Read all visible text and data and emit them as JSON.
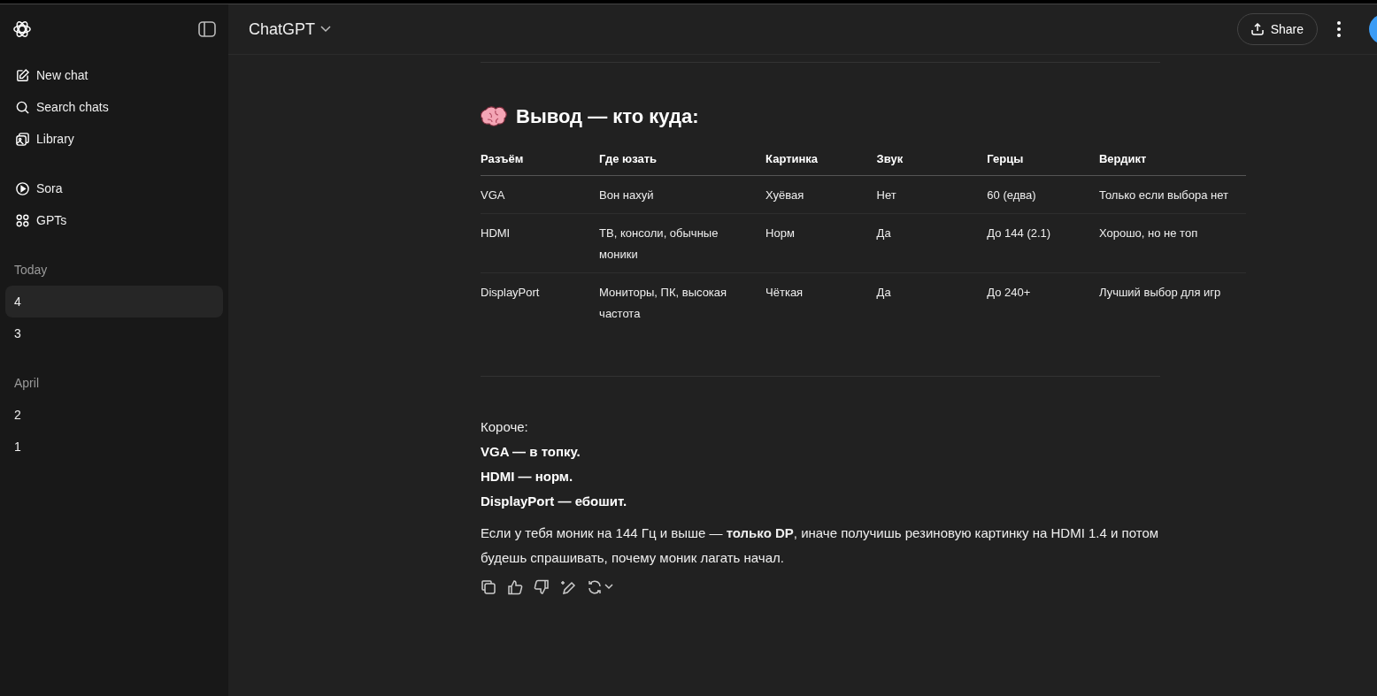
{
  "sidebar": {
    "nav": [
      {
        "kind": "new",
        "label": "New chat"
      },
      {
        "kind": "search",
        "label": "Search chats"
      },
      {
        "kind": "library",
        "label": "Library"
      },
      {
        "kind": "sora",
        "label": "Sora"
      },
      {
        "kind": "gpts",
        "label": "GPTs"
      }
    ],
    "sections": [
      {
        "title": "Today",
        "chats": [
          {
            "label": "4",
            "selected": true
          },
          {
            "label": "3",
            "selected": false
          }
        ]
      },
      {
        "title": "April",
        "chats": [
          {
            "label": "2",
            "selected": false
          },
          {
            "label": "1",
            "selected": false
          }
        ]
      }
    ]
  },
  "header": {
    "model": "ChatGPT",
    "share": "Share"
  },
  "message": {
    "heading": "Вывод — кто куда:",
    "table": {
      "columns": [
        "Разъём",
        "Где юзать",
        "Картинка",
        "Звук",
        "Герцы",
        "Вердикт"
      ],
      "rows": [
        [
          "VGA",
          "Вон нахуй",
          "Хуёвая",
          "Нет",
          "60 (едва)",
          "Только если выбора нет"
        ],
        [
          "HDMI",
          "ТВ, консоли, обычные моники",
          "Норм",
          "Да",
          "До 144 (2.1)",
          "Хорошо, но не топ"
        ],
        [
          "DisplayPort",
          "Мониторы, ПК, высокая частота",
          "Чёткая",
          "Да",
          "До 240+",
          "Лучший выбор для игр"
        ]
      ]
    },
    "summary": [
      {
        "kind": "plain",
        "text": "Короче:"
      },
      {
        "kind": "bold",
        "text": "VGA — в топку."
      },
      {
        "kind": "bold",
        "text": "HDMI — норм."
      },
      {
        "kind": "bold",
        "text": "DisplayPort — ебошит."
      }
    ],
    "paragraph": "Если у тебя моник на 144 Гц и выше — **только DP**, иначе получишь резиновую картинку на HDMI 1.4 и потом будешь спрашивать, почему моник лагать начал."
  }
}
